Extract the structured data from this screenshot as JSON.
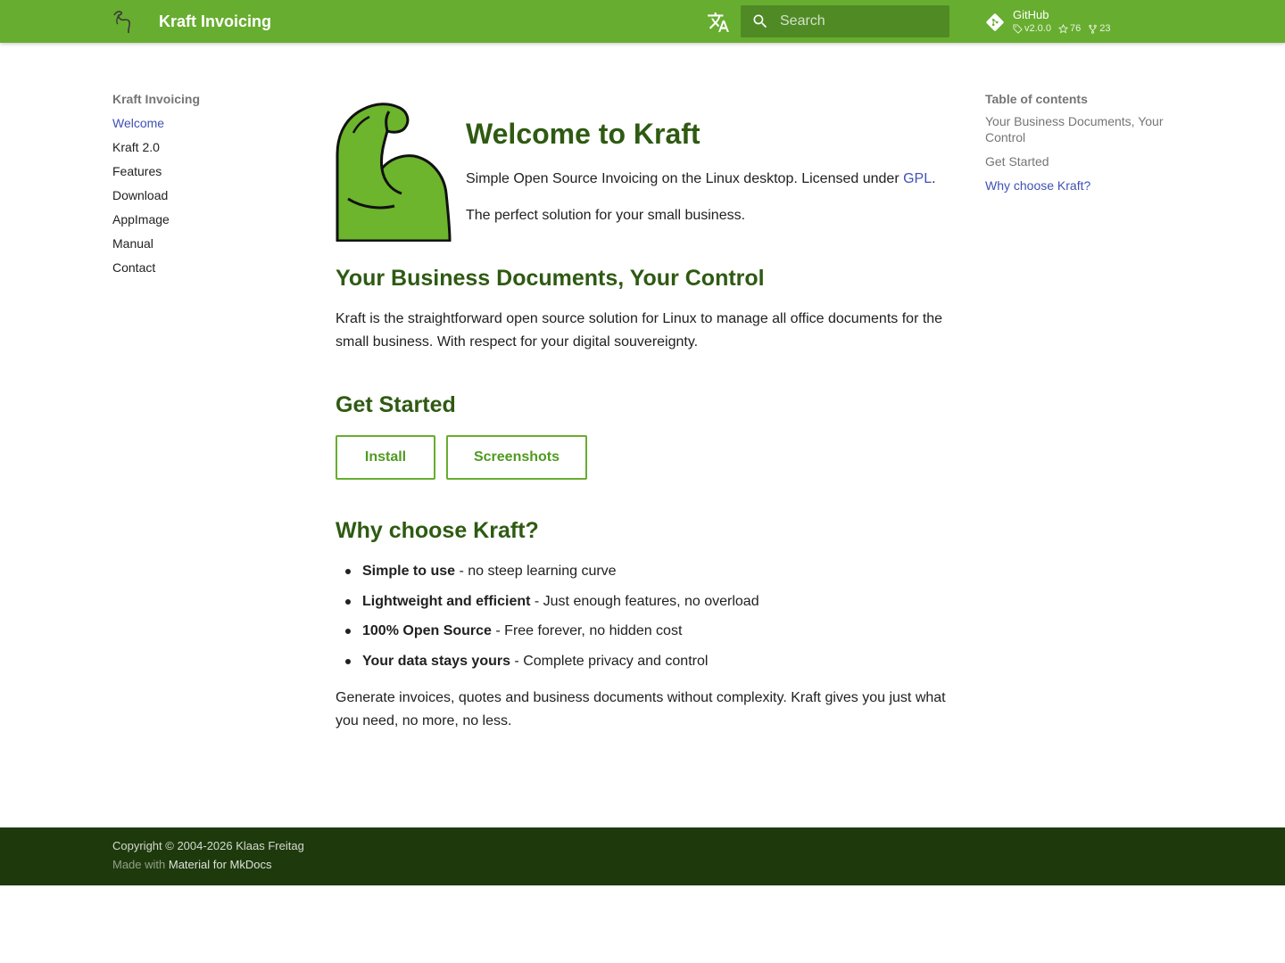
{
  "header": {
    "site_title": "Kraft Invoicing",
    "search_placeholder": "Search",
    "source": {
      "name": "GitHub",
      "version": "v2.0.0",
      "stars": "76",
      "forks": "23"
    },
    "colors": {
      "primary": "#67ad2f",
      "search_bg": "#4f8a25"
    }
  },
  "nav": {
    "title": "Kraft Invoicing",
    "items": [
      {
        "label": "Welcome",
        "active": true
      },
      {
        "label": "Kraft 2.0"
      },
      {
        "label": "Features"
      },
      {
        "label": "Download"
      },
      {
        "label": "AppImage"
      },
      {
        "label": "Manual"
      },
      {
        "label": "Contact"
      }
    ]
  },
  "main": {
    "title": "Welcome to Kraft",
    "intro_text": "Simple Open Source Invoicing on the Linux desktop. Licensed under ",
    "intro_link": "GPL",
    "intro_end": ".",
    "tagline": "The perfect solution for your small business.",
    "section1": {
      "heading": "Your Business Documents, Your Control",
      "text": "Kraft is the straightforward open source solution for Linux to manage all office documents for the small business. With respect for your digital souvereignty."
    },
    "section2": {
      "heading": "Get Started",
      "buttons": [
        "Install",
        "Screenshots"
      ]
    },
    "section3": {
      "heading": "Why choose Kraft?",
      "bullets": [
        {
          "bold": "Simple to use",
          "rest": " - no steep learning curve"
        },
        {
          "bold": "Lightweight and efficient",
          "rest": " - Just enough features, no overload"
        },
        {
          "bold": "100% Open Source",
          "rest": " - Free forever, no hidden cost"
        },
        {
          "bold": "Your data stays yours",
          "rest": " - Complete privacy and control"
        }
      ],
      "closing": "Generate invoices, quotes and business documents without complexity. Kraft gives you just what you need, no more, no less."
    }
  },
  "toc": {
    "title": "Table of contents",
    "items": [
      {
        "label": "Your Business Documents, Your Control"
      },
      {
        "label": "Get Started"
      },
      {
        "label": "Why choose Kraft?",
        "active": true
      }
    ]
  },
  "footer": {
    "copyright": "Copyright © 2004-2026 Klaas Freitag",
    "made_with_prefix": "Made with ",
    "made_with_link": "Material for MkDocs"
  },
  "icons": {
    "logo": "flexed-arm-icon",
    "language": "translate-icon",
    "search": "search-icon",
    "source": "git-icon",
    "tag": "tag-icon",
    "star": "star-icon",
    "fork": "fork-icon"
  }
}
